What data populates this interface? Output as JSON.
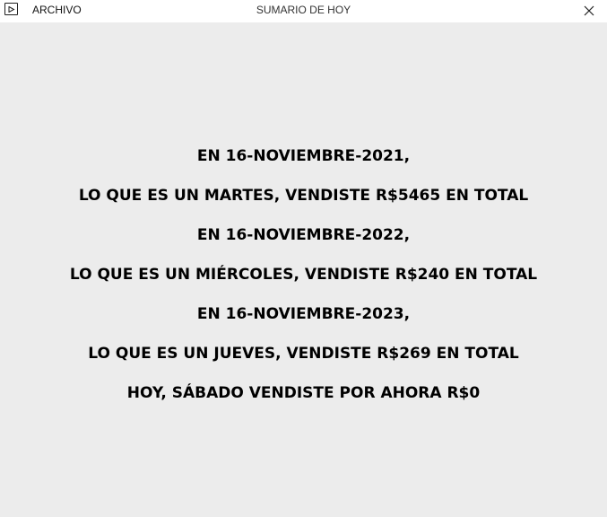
{
  "titlebar": {
    "menu_label": "ARCHIVO",
    "title": "SUMARIO DE HOY",
    "app_icon": "window-icon",
    "close_icon": "close-icon"
  },
  "summary": {
    "lines": [
      "EN 16-NOVIEMBRE-2021,",
      "LO QUE ES UN MARTES, VENDISTE R$5465 EN TOTAL",
      "EN 16-NOVIEMBRE-2022,",
      "LO QUE ES UN MIÉRCOLES, VENDISTE R$240 EN TOTAL",
      "EN 16-NOVIEMBRE-2023,",
      "LO QUE ES UN JUEVES, VENDISTE R$269 EN TOTAL",
      "HOY, SÁBADO VENDISTE POR AHORA R$0"
    ]
  }
}
